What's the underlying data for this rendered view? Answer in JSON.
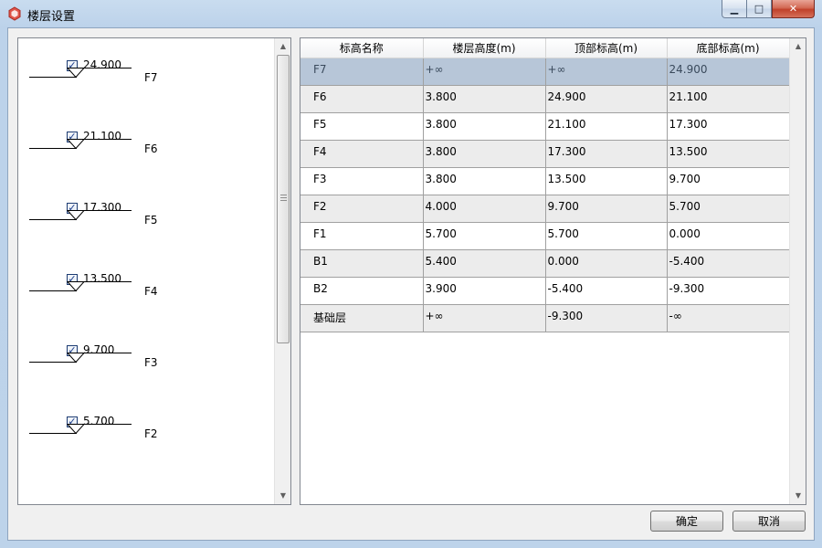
{
  "window": {
    "title": "楼层设置",
    "minimize_glyph": "▁",
    "maximize_glyph": "□",
    "close_glyph": "✕"
  },
  "left_floors": [
    {
      "elevation": "24.900",
      "name": "F7",
      "checked": true
    },
    {
      "elevation": "21.100",
      "name": "F6",
      "checked": true
    },
    {
      "elevation": "17.300",
      "name": "F5",
      "checked": true
    },
    {
      "elevation": "13.500",
      "name": "F4",
      "checked": true
    },
    {
      "elevation": "9.700",
      "name": "F3",
      "checked": true
    },
    {
      "elevation": "5.700",
      "name": "F2",
      "checked": true
    }
  ],
  "table": {
    "headers": [
      "标高名称",
      "楼层高度(m)",
      "顶部标高(m)",
      "底部标高(m)"
    ],
    "rows": [
      [
        "F7",
        "+∞",
        "+∞",
        "24.900"
      ],
      [
        "F6",
        "3.800",
        "24.900",
        "21.100"
      ],
      [
        "F5",
        "3.800",
        "21.100",
        "17.300"
      ],
      [
        "F4",
        "3.800",
        "17.300",
        "13.500"
      ],
      [
        "F3",
        "3.800",
        "13.500",
        "9.700"
      ],
      [
        "F2",
        "4.000",
        "9.700",
        "5.700"
      ],
      [
        "F1",
        "5.700",
        "5.700",
        "0.000"
      ],
      [
        "B1",
        "5.400",
        "0.000",
        "-5.400"
      ],
      [
        "B2",
        "3.900",
        "-5.400",
        "-9.300"
      ],
      [
        "基础层",
        "+∞",
        "-9.300",
        "-∞"
      ]
    ],
    "selected_row": 0
  },
  "buttons": {
    "ok_label": "确定",
    "cancel_label": "取消"
  },
  "colors": {
    "selected_row": "#b7c6d8",
    "alt_row": "#ececec",
    "title_bar": "#c9dcef"
  }
}
